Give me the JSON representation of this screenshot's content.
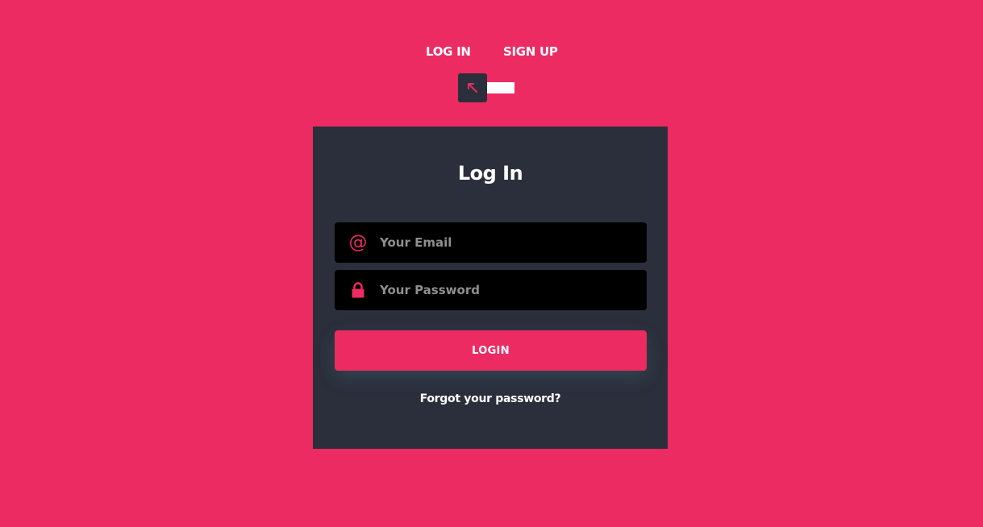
{
  "tabs": {
    "login_label": "LOG IN",
    "signup_label": "SIGN UP"
  },
  "toggle": {
    "icon": "arrow-up-left-icon",
    "state": "login"
  },
  "card": {
    "title": "Log In",
    "email": {
      "placeholder": "Your Email",
      "value": "",
      "icon": "at-sign-icon"
    },
    "password": {
      "placeholder": "Your Password",
      "value": "",
      "icon": "lock-icon"
    },
    "submit_label": "LOGIN",
    "forgot_label": "Forgot your password?"
  },
  "colors": {
    "background": "#ec2b63",
    "card": "#2b2e3b",
    "field": "#000000",
    "accent": "#ec2b63"
  }
}
